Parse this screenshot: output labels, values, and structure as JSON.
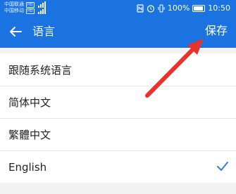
{
  "status_bar": {
    "carrier_1": "中国联通",
    "carrier_2": "中国移动",
    "hd_1": "HD",
    "hd_2": "HD",
    "battery_percent": "100%",
    "time": "10:50"
  },
  "app_bar": {
    "title": "语言",
    "save_label": "保存"
  },
  "languages": [
    {
      "label": "跟随系统语言",
      "selected": false
    },
    {
      "label": "简体中文",
      "selected": false
    },
    {
      "label": "繁體中文",
      "selected": false
    },
    {
      "label": "English",
      "selected": true
    }
  ],
  "colors": {
    "primary": "#1a73e0",
    "arrow": "#e8332a",
    "check": "#3a7be0"
  }
}
